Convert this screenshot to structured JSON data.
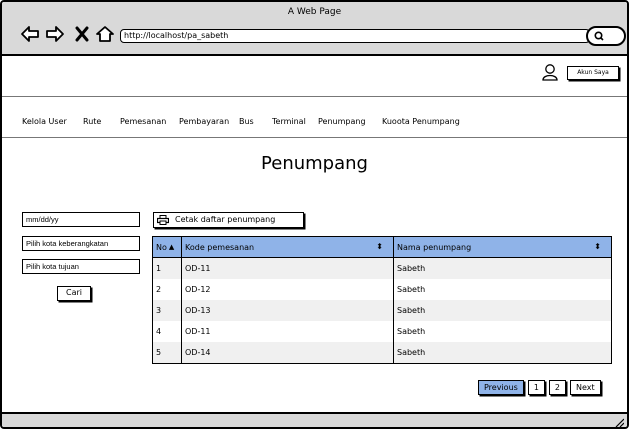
{
  "browser": {
    "window_title": "A Web Page",
    "url": "http://localhost/pa_sabeth",
    "icons": [
      "back-arrow-icon",
      "forward-arrow-icon",
      "close-x-icon",
      "home-icon",
      "search-icon"
    ]
  },
  "header": {
    "account_button": "Akun Saya",
    "user_icon": "user-icon"
  },
  "menu": {
    "items": [
      "Kelola User",
      "Rute",
      "Pemesanan",
      "Pembayaran",
      "Bus",
      "Terminal",
      "Penumpang",
      "Kuoota Penumpang"
    ]
  },
  "page": {
    "title": "Penumpang"
  },
  "filters": {
    "date_placeholder": "mm/dd/yy",
    "from_placeholder": "Pilih kota keberangkatan",
    "to_placeholder": "Pilih kota tujuan",
    "search_button": "Cari"
  },
  "actions": {
    "print_label": "Cetak daftar penumpang",
    "print_icon": "printer-icon"
  },
  "table": {
    "headers": [
      "No",
      "Kode pemesanan",
      "Nama penumpang"
    ],
    "rows": [
      [
        "1",
        "OD-11",
        "Sabeth"
      ],
      [
        "2",
        "OD-12",
        "Sabeth"
      ],
      [
        "3",
        "OD-13",
        "Sabeth"
      ],
      [
        "4",
        "OD-11",
        "Sabeth"
      ],
      [
        "5",
        "OD-14",
        "Sabeth"
      ]
    ]
  },
  "pagination": {
    "previous": "Previous",
    "pages": [
      "1",
      "2"
    ],
    "next": "Next"
  },
  "colors": {
    "accent": "#8fb3e8",
    "chrome": "#d9d9d9",
    "row_alt": "#f0f0f0"
  }
}
